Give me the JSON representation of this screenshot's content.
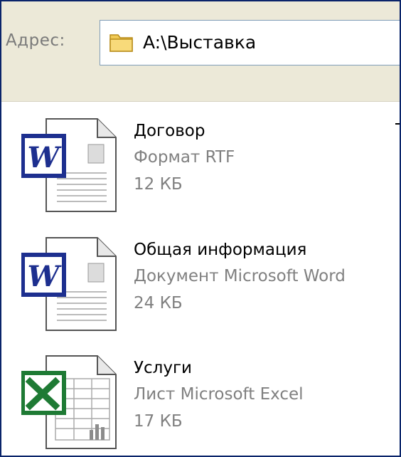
{
  "address_bar": {
    "label": "Адрес:",
    "path": "A:\\Выставка",
    "icon": "folder-icon"
  },
  "files": [
    {
      "name": "Договор",
      "type": "Формат RTF",
      "size": "12 КБ",
      "icon": "word-document-icon"
    },
    {
      "name": "Общая информация",
      "type": "Документ Microsoft Word",
      "size": "24 КБ",
      "icon": "word-document-icon"
    },
    {
      "name": "Услуги",
      "type": "Лист Microsoft Excel",
      "size": "17 КБ",
      "icon": "excel-sheet-icon"
    }
  ],
  "colors": {
    "toolbar_bg": "#ece9d8",
    "word_blue": "#1d2f8f",
    "excel_green": "#1e7a34",
    "meta_text": "#808080"
  }
}
